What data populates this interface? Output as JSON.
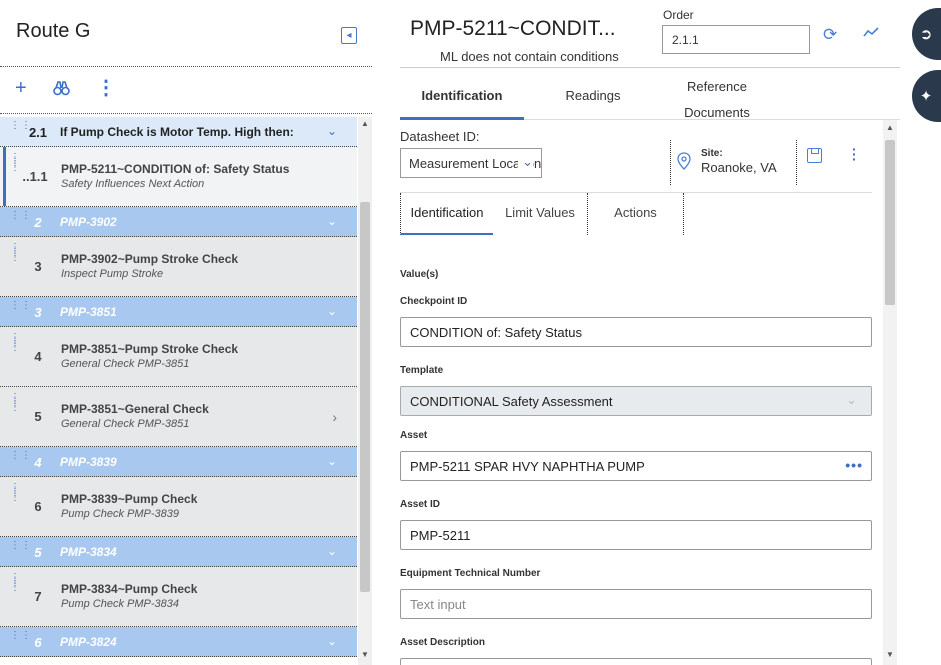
{
  "left": {
    "title": "Route G",
    "toolbar": {
      "add": "+",
      "find": "⌕",
      "more": "⋮"
    },
    "rows": [
      {
        "kind": "group",
        "num": "2.1",
        "title": "If Pump Check is Motor Temp. High then:"
      },
      {
        "kind": "item",
        "num": "..1.1",
        "title": "PMP-5211~CONDITION of: Safety Status",
        "subtitle": "Safety Influences Next Action"
      },
      {
        "kind": "group",
        "num": "2",
        "title": "PMP-3902"
      },
      {
        "kind": "item",
        "num": "3",
        "title": "PMP-3902~Pump Stroke Check",
        "subtitle": "Inspect Pump Stroke"
      },
      {
        "kind": "group",
        "num": "3",
        "title": "PMP-3851"
      },
      {
        "kind": "item",
        "num": "4",
        "title": "PMP-3851~Pump Stroke Check",
        "subtitle": "General Check PMP-3851"
      },
      {
        "kind": "item",
        "num": "5",
        "title": "PMP-3851~General Check",
        "subtitle": "General Check PMP-3851"
      },
      {
        "kind": "group",
        "num": "4",
        "title": "PMP-3839"
      },
      {
        "kind": "item",
        "num": "6",
        "title": "PMP-3839~Pump Check",
        "subtitle": "Pump Check PMP-3839"
      },
      {
        "kind": "group",
        "num": "5",
        "title": "PMP-3834"
      },
      {
        "kind": "item",
        "num": "7",
        "title": "PMP-3834~Pump Check",
        "subtitle": "Pump Check PMP-3834"
      },
      {
        "kind": "group",
        "num": "6",
        "title": "PMP-3824"
      }
    ]
  },
  "right": {
    "title": "PMP-5211~CONDIT...",
    "subtitle": "ML does not contain conditions",
    "order_label": "Order",
    "order_value": "2.1.1",
    "tabs": {
      "identification": "Identification",
      "readings": "Readings",
      "reference_1": "Reference",
      "reference_2": "Documents"
    },
    "datasheet_label": "Datasheet ID:",
    "datasheet_value": "Measurement Location",
    "site_label": "Site:",
    "site_value": "Roanoke, VA",
    "subtabs": {
      "identification": "Identification",
      "limits": "Limit Values",
      "actions": "Actions"
    },
    "form": {
      "values_heading": "Value(s)",
      "checkpoint_label": "Checkpoint ID",
      "checkpoint_value": "CONDITION of: Safety Status",
      "template_label": "Template",
      "template_value": "CONDITIONAL Safety Assessment",
      "asset_label": "Asset",
      "asset_value": "PMP-5211 SPAR HVY NAPHTHA PUMP",
      "asset_id_label": "Asset ID",
      "asset_id_value": "PMP-5211",
      "etn_label": "Equipment Technical Number",
      "etn_placeholder": "Text input",
      "asset_desc_label": "Asset Description"
    }
  },
  "colors": {
    "accent": "#3d6fc4",
    "group_row": "#a8c8ef",
    "item_row": "#e6e8ea",
    "side_button": "#2a3a4c"
  }
}
